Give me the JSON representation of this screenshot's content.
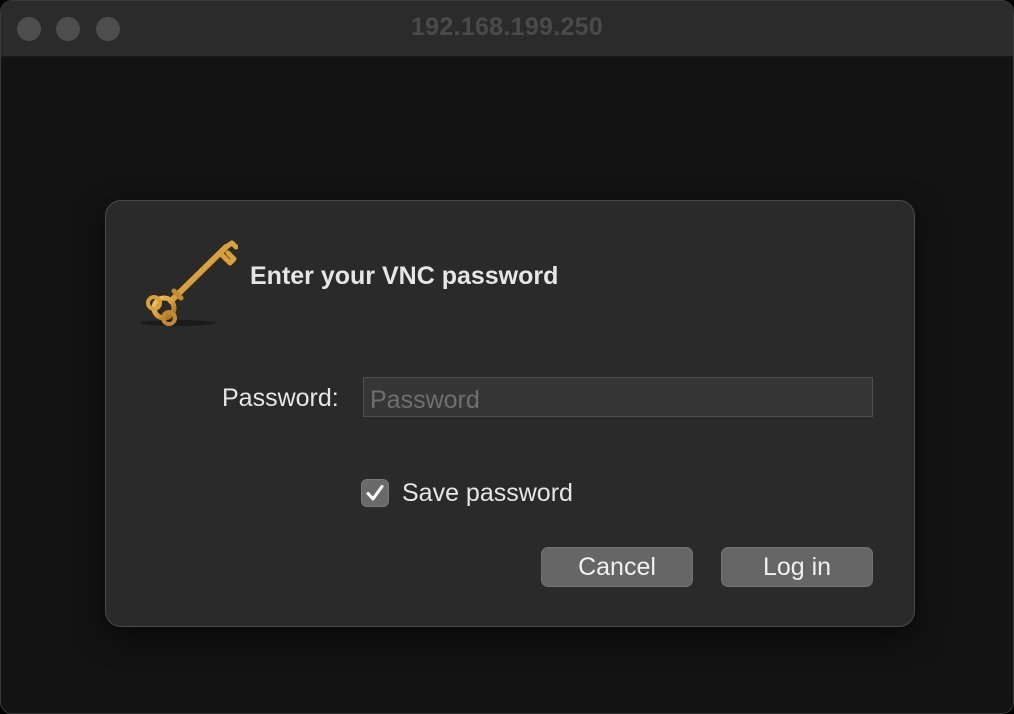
{
  "window": {
    "title": "192.168.199.250"
  },
  "dialog": {
    "icon": "key-icon",
    "title": "Enter your VNC password",
    "password": {
      "label": "Password:",
      "value": "",
      "placeholder": "Password"
    },
    "save_password": {
      "label": "Save password",
      "checked": true
    },
    "buttons": {
      "cancel": "Cancel",
      "login": "Log in"
    }
  },
  "colors": {
    "dialog_bg": "#2a2a2a",
    "window_bg": "#131313",
    "titlebar_bg": "#2b2b2b",
    "button_bg": "#666666",
    "key_gold": "#d9a13a"
  }
}
